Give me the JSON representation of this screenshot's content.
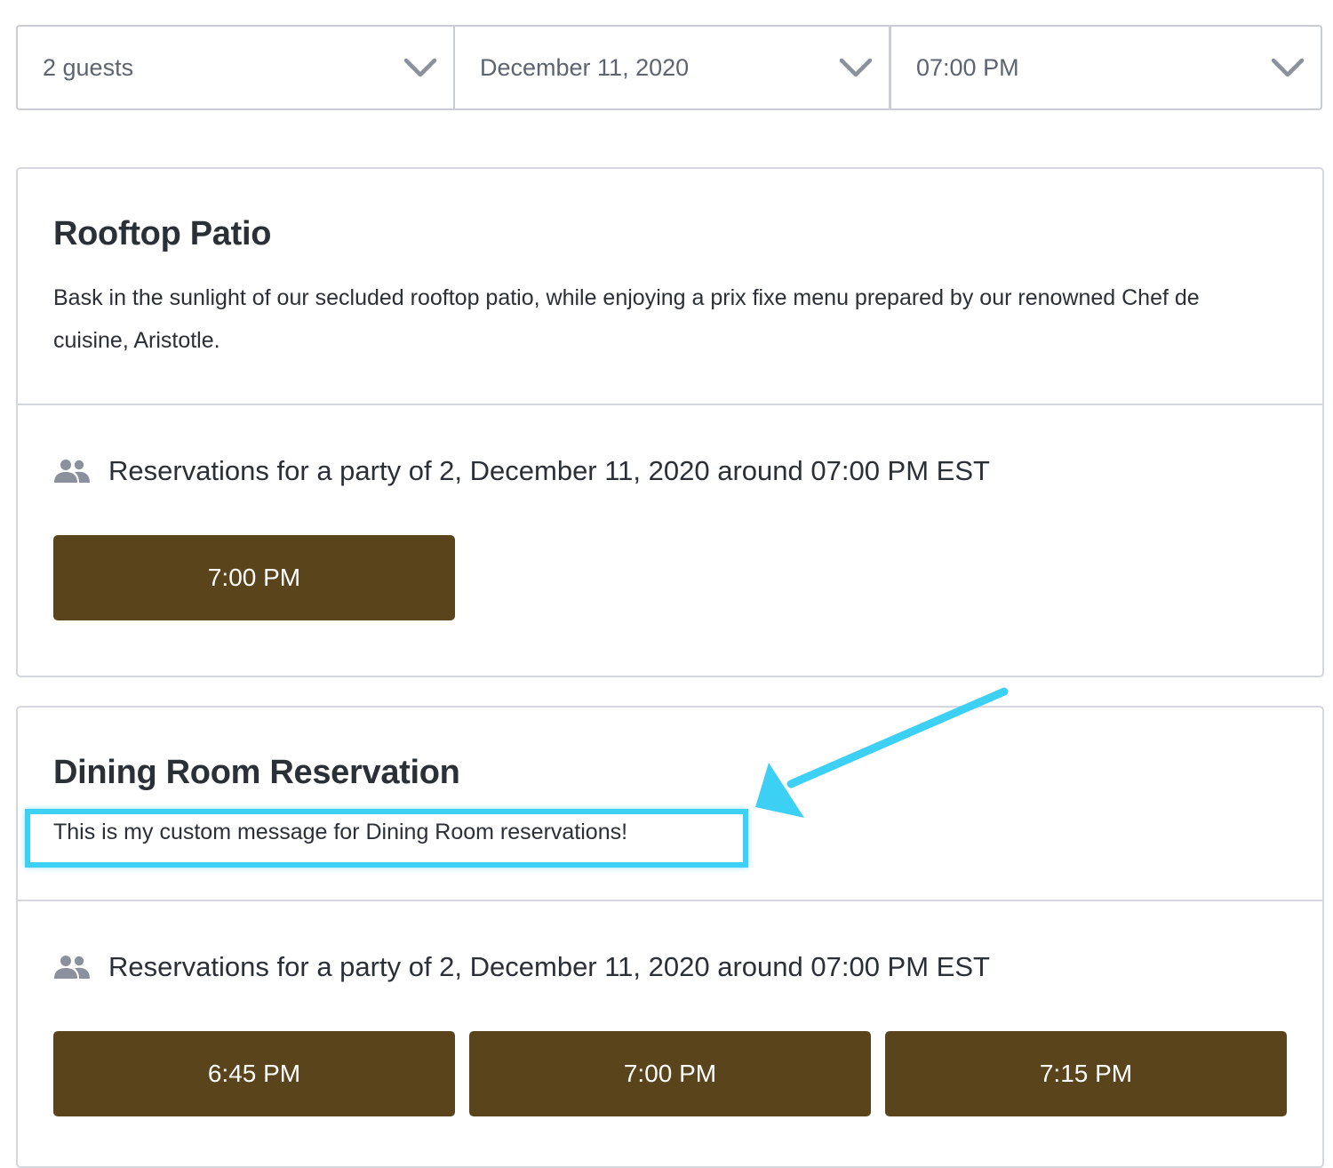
{
  "selectors": {
    "guests": "2 guests",
    "date": "December 11, 2020",
    "time": "07:00 PM"
  },
  "cards": [
    {
      "title": "Rooftop Patio",
      "description": "Bask in the sunlight of our secluded rooftop patio, while enjoying a prix fixe menu prepared by our renowned Chef de cuisine, Aristotle.",
      "party_text": "Reservations for a party of 2, December 11, 2020 around 07:00 PM EST",
      "slots": [
        "7:00 PM"
      ]
    },
    {
      "title": "Dining Room Reservation",
      "description": "This is my custom message for Dining Room reservations!",
      "party_text": "Reservations for a party of 2, December 11, 2020 around 07:00 PM EST",
      "slots": [
        "6:45 PM",
        "7:00 PM",
        "7:15 PM"
      ]
    }
  ],
  "colors": {
    "slot_button": "#5a441b",
    "annotation": "#3dd0f5",
    "border": "#d4d7dc",
    "muted_icon": "#8a919c"
  },
  "icons": {
    "dropdown": "chevron-down-icon",
    "party": "people-icon",
    "annotation_arrow": "arrow-icon"
  }
}
